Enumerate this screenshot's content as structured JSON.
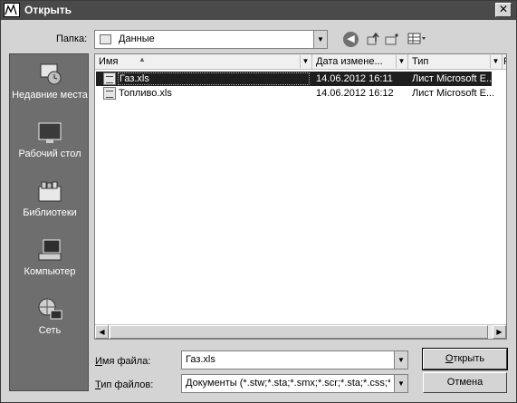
{
  "window": {
    "title": "Открыть"
  },
  "toolbar": {
    "folder_label": "Папка:",
    "folder_value": "Данные",
    "icons": [
      "back-icon",
      "up-folder-icon",
      "new-folder-icon",
      "views-menu-icon"
    ]
  },
  "places": [
    {
      "label": "Недавние места",
      "icon": "recent-places-icon"
    },
    {
      "label": "Рабочий стол",
      "icon": "desktop-icon"
    },
    {
      "label": "Библиотеки",
      "icon": "libraries-icon"
    },
    {
      "label": "Компьютер",
      "icon": "computer-icon"
    },
    {
      "label": "Сеть",
      "icon": "network-icon"
    }
  ],
  "filelist": {
    "columns": [
      "Имя",
      "Дата измене...",
      "Тип",
      "Р"
    ],
    "rows": [
      {
        "name": "Газ.xls",
        "date": "14.06.2012 16:11",
        "type": "Лист Microsoft E...",
        "selected": true
      },
      {
        "name": "Топливо.xls",
        "date": "14.06.2012 16:12",
        "type": "Лист Microsoft E...",
        "selected": false
      }
    ]
  },
  "bottom": {
    "filename_label_prefix": "И",
    "filename_label_rest": "мя файла:",
    "filename_value": "Газ.xls",
    "filetype_label_prefix": "Т",
    "filetype_label_rest": "ип файлов:",
    "filetype_value": "Документы (*.stw;*.sta;*.smx;*.scr;*.sta;*.css;*.xl",
    "open_prefix": "О",
    "open_rest": "ткрыть",
    "cancel": "Отмена"
  },
  "colors": {
    "titlebar": "#4a4a4a",
    "places_bg": "#6e6e6e",
    "selection": "#1e1e1e"
  }
}
